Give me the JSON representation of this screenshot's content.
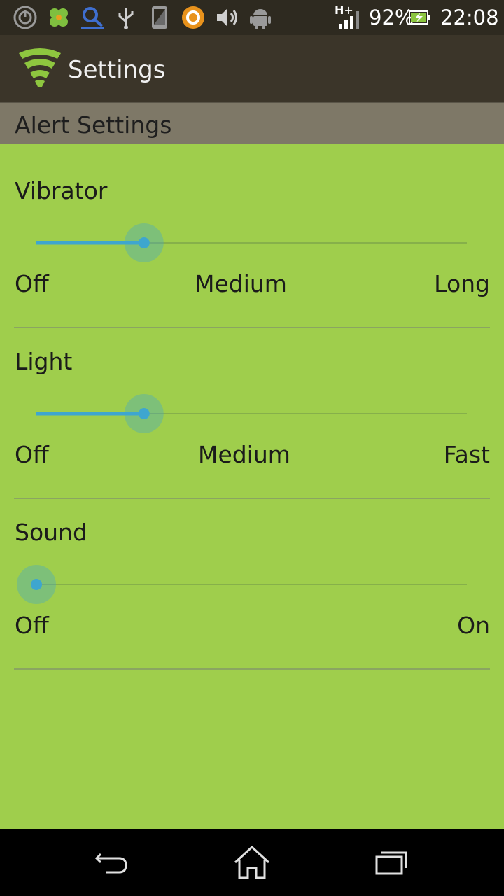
{
  "status_bar": {
    "battery": "92%",
    "time": "22:08",
    "network": "H+",
    "left_icons": [
      "power-icon",
      "clover-icon",
      "search-app-icon",
      "usb-icon",
      "phone-icon",
      "app-circle-icon",
      "volume-icon",
      "android-icon"
    ]
  },
  "action_bar": {
    "title": "Settings"
  },
  "section": {
    "title": "Alert Settings"
  },
  "settings": [
    {
      "title": "Vibrator",
      "value_fraction": 0.25,
      "labels": [
        "Off",
        "Medium",
        "Long"
      ]
    },
    {
      "title": "Light",
      "value_fraction": 0.25,
      "labels": [
        "Off",
        "Medium",
        "Fast"
      ]
    },
    {
      "title": "Sound",
      "value_fraction": 0.0,
      "labels": [
        "Off",
        "On"
      ]
    }
  ],
  "colors": {
    "background": "#9fce4c",
    "slider_accent": "#3ea6cf",
    "action_bar": "#3b3529",
    "section_header": "#7e7867"
  },
  "nav": [
    "back-icon",
    "home-icon",
    "recent-apps-icon"
  ]
}
